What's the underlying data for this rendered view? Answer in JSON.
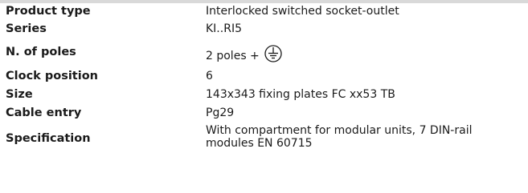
{
  "rows": [
    {
      "label": "Product type",
      "value": "Interlocked switched socket-outlet"
    },
    {
      "label": "Series",
      "value": "KI..RI5"
    },
    {
      "label": "N. of poles",
      "value": "2 poles +",
      "icon": "earth-ground-icon"
    },
    {
      "label": "Clock position",
      "value": "6"
    },
    {
      "label": "Size",
      "value": "143x343 fixing plates FC xx53 TB"
    },
    {
      "label": "Cable entry",
      "value": "Pg29"
    },
    {
      "label": "Specification",
      "value_lines": [
        "With compartment for modular units, 7 DIN-rail",
        "modules EN 60715"
      ]
    }
  ]
}
